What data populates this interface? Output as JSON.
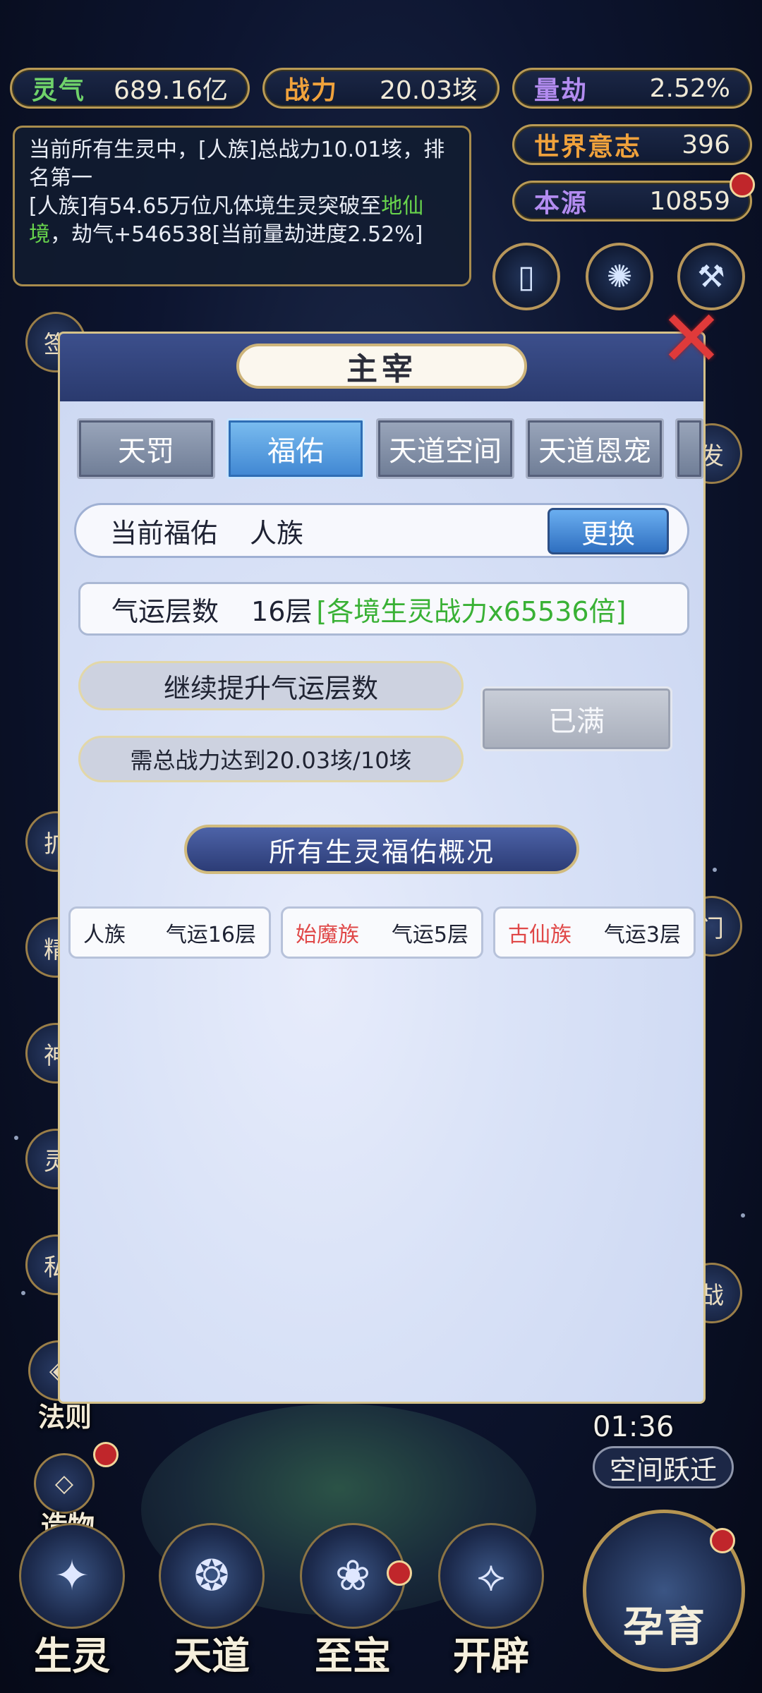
{
  "stats": {
    "lingqi": {
      "label": "灵气",
      "value": "689.16亿"
    },
    "zhanli": {
      "label": "战力",
      "value": "20.03垓"
    },
    "liangjie": {
      "label": "量劫",
      "value": "2.52%"
    },
    "world_will": {
      "label": "世界意志",
      "value": "396"
    },
    "origin": {
      "label": "本源",
      "value": "10859"
    }
  },
  "notice": {
    "line1": "当前所有生灵中，[人族]总战力10.01垓，排名第一",
    "line2_prefix": "[人族]有54.65万位凡体境生灵突破至",
    "line2_green": "地仙境",
    "line2_suffix": "，劫气+546538[当前量劫进度2.52%]"
  },
  "side_left": [
    {
      "label": "签"
    },
    {
      "label": "扩"
    },
    {
      "label": "精"
    },
    {
      "label": "神"
    },
    {
      "label": "灵"
    },
    {
      "label": "私"
    },
    {
      "label": "法则"
    },
    {
      "label": "造物"
    }
  ],
  "side_right": [
    {
      "label": "发"
    },
    {
      "label": "门"
    },
    {
      "label": "战"
    }
  ],
  "modal": {
    "title": "主宰",
    "tabs": [
      "天罚",
      "福佑",
      "天道空间",
      "天道恩宠"
    ],
    "active_tab": "福佑",
    "current_label": "当前福佑",
    "current_value": "人族",
    "swap_label": "更换",
    "fortune_label": "气运层数",
    "fortune_value": "16层",
    "fortune_bonus": "[各境生灵战力x65536倍]",
    "upgrade_label": "继续提升气运层数",
    "requirement": "需总战力达到20.03垓/10垓",
    "full_label": "已满",
    "overview_title": "所有生灵福佑概况",
    "races": [
      {
        "name": "人族",
        "fortune": "气运16层",
        "highlight": false
      },
      {
        "name": "始魔族",
        "fortune": "气运5层",
        "highlight": true
      },
      {
        "name": "古仙族",
        "fortune": "气运3层",
        "highlight": true
      }
    ]
  },
  "space_jump": {
    "timer": "01:36",
    "label": "空间跃迁"
  },
  "bottom_nav": [
    "生灵",
    "天道",
    "至宝",
    "开辟"
  ],
  "breed_label": "孕育",
  "colors": {
    "accent_gold": "#b99a55",
    "green": "#39b135",
    "red": "#e04848",
    "panel_blue": "#2a3a6e"
  }
}
